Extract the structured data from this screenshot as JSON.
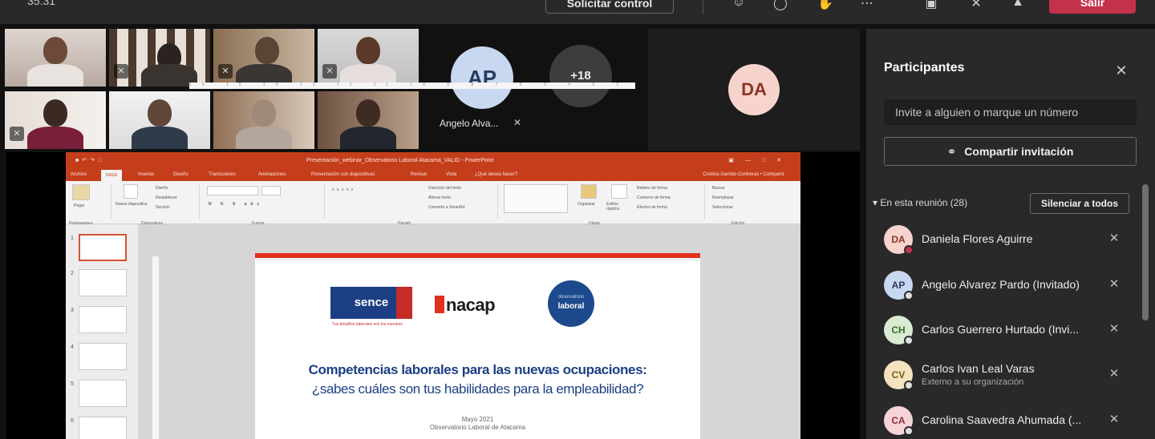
{
  "topbar": {
    "clock": "35:31",
    "request_control": "Solicitar control",
    "leave": "Salir",
    "icons": [
      "people-icon",
      "chat-icon",
      "hand-icon",
      "more-icon",
      "camera-off-icon",
      "mic-off-icon",
      "share-icon"
    ]
  },
  "stage": {
    "avatar_ap_initials": "AP",
    "avatar_ap_name": "Angelo Alva...",
    "overflow_count": "+18",
    "avatar_da_initials": "DA"
  },
  "powerpoint": {
    "window_title": "Presentación_webinar_Observatorio Laboral Atacama_VALID - PowerPoint",
    "user": "Cristina Garrido Contreras",
    "share_label": "Compartir",
    "tabs": [
      "Archivo",
      "Inicio",
      "Insertar",
      "Diseño",
      "Transiciones",
      "Animaciones",
      "Presentación con diapositivas",
      "Revisar",
      "Vista",
      "¿Qué desea hacer?"
    ],
    "ribbon_groups": [
      "Portapapeles",
      "Diapositivas",
      "Fuente",
      "Párrafo",
      "Dibujo",
      "Edición"
    ],
    "ribbon_items": {
      "paste": "Pegar",
      "new_slide": "Nueva diapositiva",
      "layout": "Diseño",
      "reset": "Restablecer",
      "section": "Sección",
      "text_direction": "Dirección del texto",
      "align_text": "Alinear texto",
      "smartart": "Convertir a SmartArt",
      "arrange": "Organizar",
      "quick_styles": "Estilos rápidos",
      "fill": "Relleno de forma",
      "outline": "Contorno de forma",
      "effects": "Efectos de forma",
      "find": "Buscar",
      "replace": "Reemplazar",
      "select": "Seleccionar"
    },
    "ruler": "16 15 14 13 12 11 10 9 8 7 6 5 4 3 2 1 0 1 2 3 4 5 6 7 8 9 10 11 12 13 14 15 16",
    "slide_numbers": [
      "1",
      "2",
      "3",
      "4",
      "5",
      "6"
    ],
    "slide": {
      "logo_sence": "sence",
      "sence_tagline": "Tus desafíos laborales son los nuestros",
      "logo_inacap": "nacap",
      "logo_obs_top": "observatorio",
      "logo_obs_main": "laboral",
      "heading": "Competencias laborales para las nuevas ocupaciones:",
      "subheading": "¿sabes cuáles son tus habilidades para la empleabilidad?",
      "date": "Mayo 2021",
      "org": "Observatorio Laboral de Atacama"
    }
  },
  "participants": {
    "title": "Participantes",
    "invite_placeholder": "Invite a alguien o marque un número",
    "share_invite": "Compartir invitación",
    "section_label": "En esta reunión (28)",
    "mute_all": "Silenciar a todos",
    "list": [
      {
        "initials": "DA",
        "name": "Daniela Flores Aguirre",
        "sub": "",
        "av_bg": "#f6d3cd",
        "av_fg": "#8c3425",
        "dot": "#c4314b"
      },
      {
        "initials": "AP",
        "name": "Angelo Alvarez Pardo (Invitado)",
        "sub": "",
        "av_bg": "#c8d8f0",
        "av_fg": "#283a5e",
        "dot": "#e0e0e0"
      },
      {
        "initials": "CH",
        "name": "Carlos Guerrero Hurtado (Invi...",
        "sub": "",
        "av_bg": "#d9ebd3",
        "av_fg": "#3b6b2e",
        "dot": "#e0e0e0"
      },
      {
        "initials": "CV",
        "name": "Carlos Ivan Leal Varas",
        "sub": "Externo a su organización",
        "av_bg": "#f4e3bf",
        "av_fg": "#7a5a12",
        "dot": "#e0e0e0"
      },
      {
        "initials": "CA",
        "name": "Carolina Saavedra Ahumada (...",
        "sub": "",
        "av_bg": "#f6d3d7",
        "av_fg": "#8a2f3c",
        "dot": "#e0e0e0"
      }
    ]
  }
}
